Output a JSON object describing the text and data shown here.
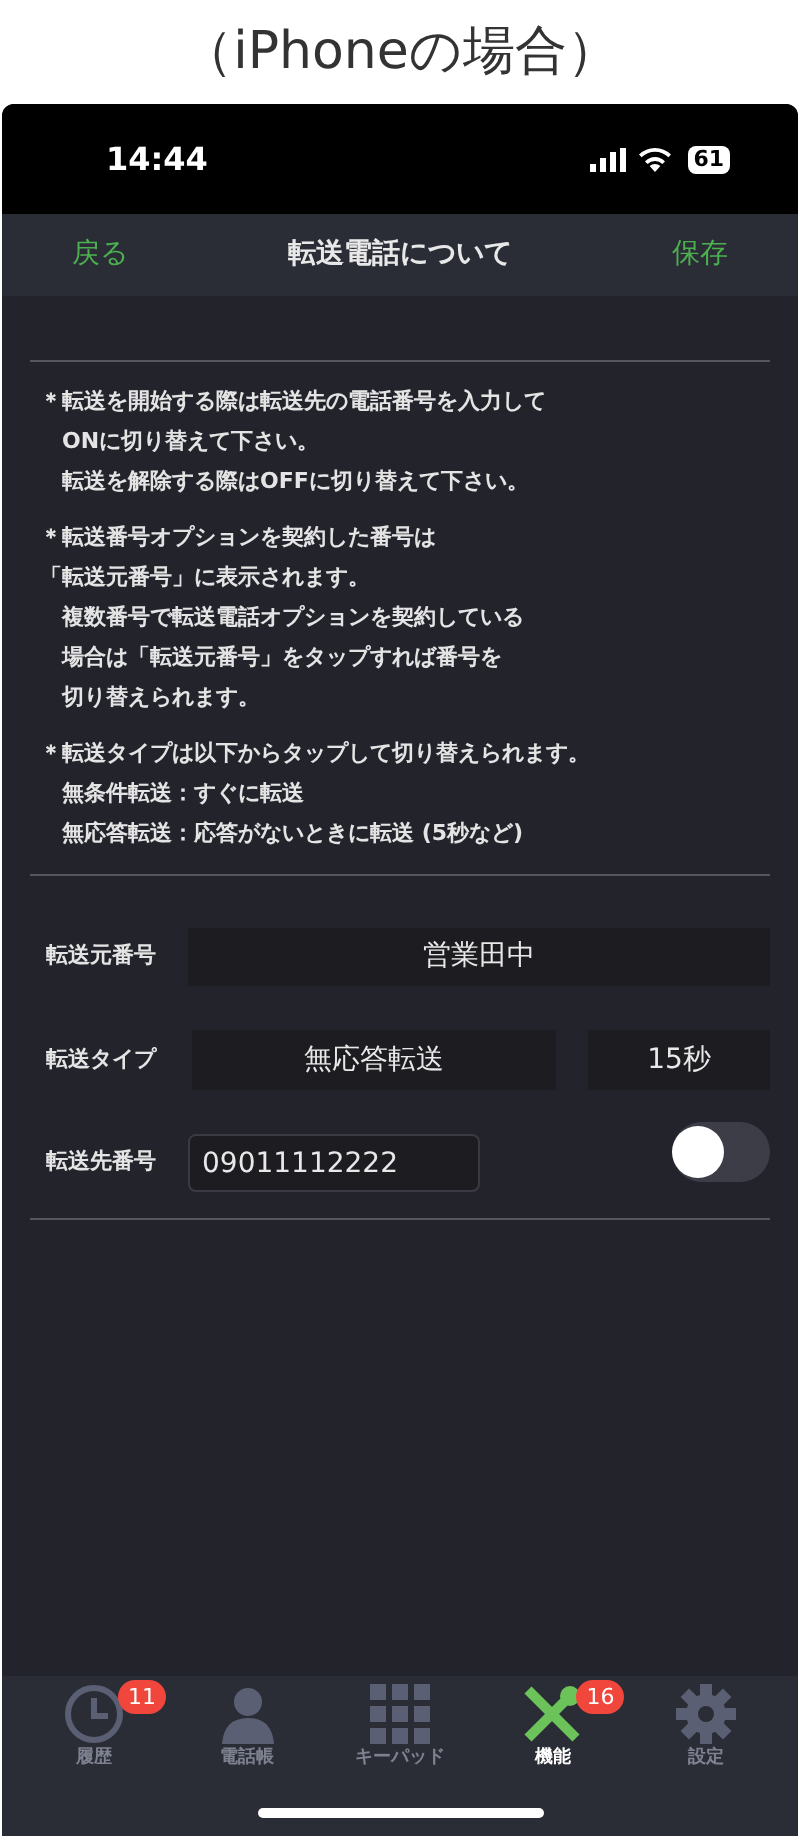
{
  "caption": "（iPhoneの場合）",
  "status_bar": {
    "time": "14:44",
    "battery": "61"
  },
  "nav_bar": {
    "back": "戻る",
    "title": "転送電話について",
    "save": "保存"
  },
  "notes": [
    {
      "lines": [
        "＊転送を開始する際は転送先の電話番号を入力して",
        "　ONに切り替えて下さい。",
        "　転送を解除する際はOFFに切り替えて下さい。"
      ]
    },
    {
      "lines": [
        "＊転送番号オプションを契約した番号は",
        "「転送元番号」に表示されます。",
        "　複数番号で転送電話オプションを契約している",
        "　場合は「転送元番号」をタップすれば番号を",
        "　切り替えられます。"
      ]
    },
    {
      "lines": [
        "＊転送タイプは以下からタップして切り替えられます。",
        "　無条件転送：すぐに転送",
        "　無応答転送：応答がないときに転送 (5秒など)"
      ]
    }
  ],
  "form": {
    "source": {
      "label": "転送元番号",
      "value": "営業田中"
    },
    "type": {
      "label": "転送タイプ",
      "value": "無応答転送",
      "delay": "15秒"
    },
    "destination": {
      "label": "転送先番号",
      "value": "09011112222",
      "on": false
    }
  },
  "tab_bar": [
    {
      "kind": "clock",
      "label": "履歴",
      "badge": "11",
      "selected": false
    },
    {
      "kind": "person",
      "label": "電話帳",
      "selected": false
    },
    {
      "kind": "keypad",
      "label": "キーパッド",
      "selected": false
    },
    {
      "kind": "tools",
      "label": "機能",
      "badge": "16",
      "selected": true
    },
    {
      "kind": "gear",
      "label": "設定",
      "selected": false
    }
  ]
}
